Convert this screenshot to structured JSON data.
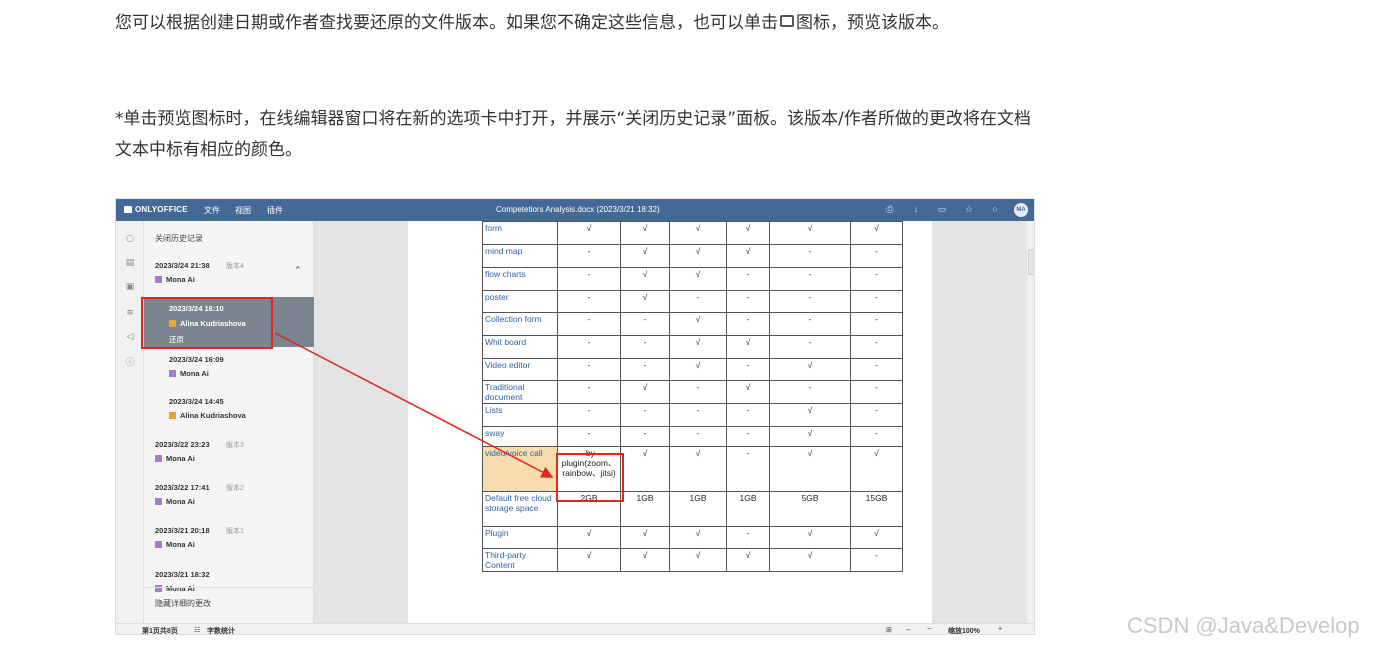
{
  "article": {
    "para1_before": "您可以根据创建日期或作者查找要还原的文件版本。如果您不确定这些信息，也可以单击",
    "para1_after": "图标，预览该版本。",
    "para2": "*单击预览图标时，在线编辑器窗口将在新的选项卡中打开，并展示“关闭历史记录”面板。该版本/作者所做的更改将在文档文本中标有相应的颜色。",
    "preview_icon": "monitor-icon"
  },
  "watermark": "CSDN @Java&Develop",
  "editor": {
    "logo": "ONLYOFFICE",
    "menus": [
      "文件",
      "视图",
      "插件"
    ],
    "doc_title": "Competetiors Analysis.docx (2023/3/21 18:32)",
    "avatar": "MA",
    "top_icons": [
      "print-icon",
      "download-icon",
      "folder-icon",
      "star-icon",
      "search-icon"
    ],
    "left_icons": [
      "search-icon",
      "comment-icon",
      "chat-icon",
      "headings-icon",
      "speaker-icon",
      "info-icon"
    ],
    "history": {
      "title": "关闭历史记录",
      "entries": [
        {
          "date": "2023/3/24 21:38",
          "version": "版本4",
          "author": "Mona Ai",
          "color": "#a97ad6"
        },
        {
          "date": "2023/3/24 16:10",
          "version": "",
          "author": "Alina Kudriashova",
          "color": "#f0a03a",
          "restore": "还原"
        },
        {
          "date": "2023/3/24 16:09",
          "version": "",
          "author": "Mona Ai",
          "color": "#a97ad6"
        },
        {
          "date": "2023/3/24 14:45",
          "version": "",
          "author": "Alina Kudriashova",
          "color": "#f0a03a"
        },
        {
          "date": "2023/3/22 23:23",
          "version": "版本3",
          "author": "Mona Ai",
          "color": "#a97ad6"
        },
        {
          "date": "2023/3/22 17:41",
          "version": "版本2",
          "author": "Mona Ai",
          "color": "#a97ad6"
        },
        {
          "date": "2023/3/21 20:18",
          "version": "版本1",
          "author": "Mona Ai",
          "color": "#a97ad6"
        },
        {
          "date": "2023/3/21 18:32",
          "version": "",
          "author": "Mona Ai",
          "color": "#a97ad6"
        }
      ],
      "hide_changes": "隐藏详细的更改"
    },
    "table": {
      "rows": [
        [
          "form",
          "√",
          "√",
          "√",
          "√",
          "√",
          "√"
        ],
        [
          "mind map",
          "-",
          "√",
          "√",
          "√",
          "-",
          "-"
        ],
        [
          "flow charts",
          "-",
          "√",
          "√",
          "-",
          "-",
          "-"
        ],
        [
          "poster",
          "-",
          "√",
          "-",
          "-",
          "-",
          "-"
        ],
        [
          "Collection form",
          "-",
          "-",
          "√",
          "-",
          "-",
          "-"
        ],
        [
          "Whit board",
          "-",
          "-",
          "√",
          "√",
          "-",
          "-"
        ],
        [
          "Video editor",
          "-",
          "-",
          "√",
          "-",
          "√",
          "-"
        ],
        [
          "Traditional document",
          "-",
          "√",
          "-",
          "√",
          "-",
          "-"
        ],
        [
          "Lists",
          "-",
          "-",
          "-",
          "-",
          "√",
          "-"
        ],
        [
          "sway",
          "-",
          "-",
          "-",
          "-",
          "√",
          "-"
        ],
        [
          "video/voice call",
          "-by plugin(zoom、rainbow、jitsi)",
          "√",
          "√",
          "-",
          "√",
          "√"
        ],
        [
          "Default free cloud storage space",
          "2GB",
          "1GB",
          "1GB",
          "1GB",
          "5GB",
          "15GB"
        ],
        [
          "Plugin",
          "√",
          "√",
          "√",
          "-",
          "√",
          "√"
        ],
        [
          "Third-party Content",
          "√",
          "√",
          "√",
          "√",
          "√",
          "-"
        ]
      ]
    },
    "status": {
      "page": "第1页共8页",
      "word_count": "字数统计",
      "zoom": "缩放100%"
    }
  }
}
